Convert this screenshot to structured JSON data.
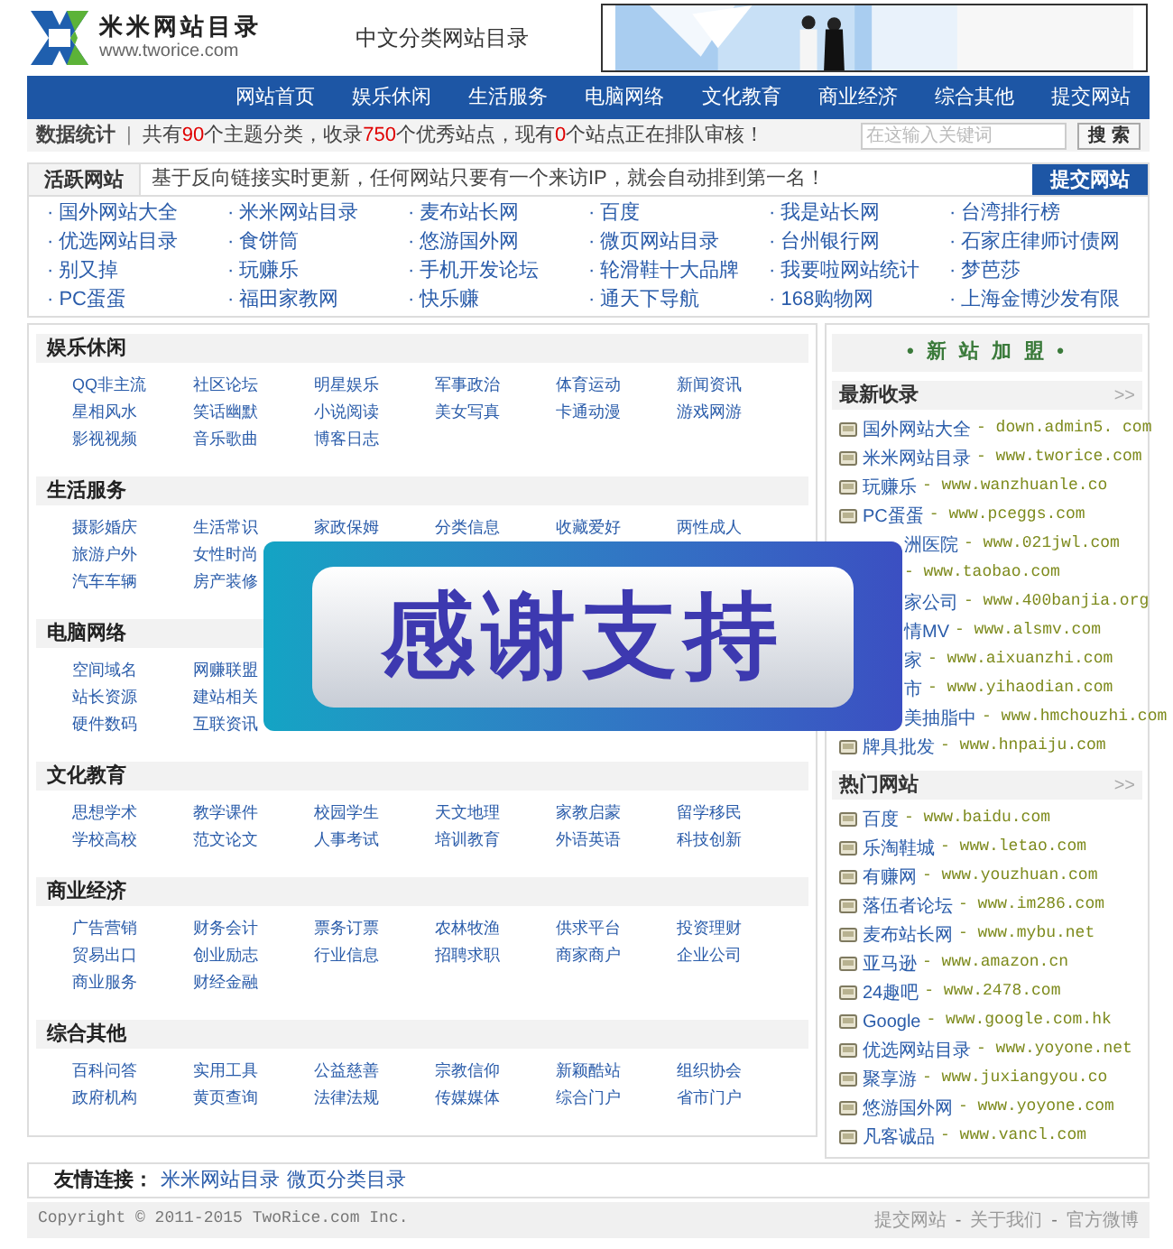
{
  "header": {
    "logo_name": "米米网站目录",
    "logo_url": "www.tworice.com",
    "site_title": "中文分类网站目录"
  },
  "nav": [
    "网站首页",
    "娱乐休闲",
    "生活服务",
    "电脑网络",
    "文化教育",
    "商业经济",
    "综合其他",
    "提交网站"
  ],
  "stats": {
    "label": "数据统计",
    "separator": "|",
    "parts": [
      {
        "text": "共有",
        "highlight": false
      },
      {
        "text": "90",
        "highlight": true
      },
      {
        "text": "个主题分类，收录",
        "highlight": false
      },
      {
        "text": "750",
        "highlight": true
      },
      {
        "text": "个优秀站点，现有",
        "highlight": false
      },
      {
        "text": "0",
        "highlight": true
      },
      {
        "text": "个站点正在排队审核！",
        "highlight": false
      }
    ],
    "search": {
      "placeholder": "在这输入关键词"
    },
    "search_button": "搜 索"
  },
  "active_sites": {
    "label": "活跃网站",
    "notice": "基于反向链接实时更新，任何网站只要有一个来访IP，就会自动排到第一名！",
    "submit": "提交网站",
    "links": [
      "· 国外网站大全",
      "· 米米网站目录",
      "· 麦布站长网",
      "· 百度",
      "· 我是站长网",
      "· 台湾排行榜",
      "· 优选网站目录",
      "· 食饼筒",
      "· 悠游国外网",
      "· 微页网站目录",
      "· 台州银行网",
      "· 石家庄律师讨债网",
      "· 别又掉",
      "· 玩赚乐",
      "· 手机开发论坛",
      "· 轮滑鞋十大品牌",
      "· 我要啦网站统计",
      "· 梦芭莎",
      "· PC蛋蛋",
      "· 福田家教网",
      "· 快乐赚",
      "· 通天下导航",
      "· 168购物网",
      "· 上海金博沙发有限"
    ]
  },
  "categories": [
    {
      "title": "娱乐休闲",
      "links": [
        [
          "QQ非主流",
          "社区论坛",
          "明星娱乐",
          "军事政治",
          "体育运动",
          "新闻资讯"
        ],
        [
          "星相风水",
          "笑话幽默",
          "小说阅读",
          "美女写真",
          "卡通动漫",
          "游戏网游"
        ],
        [
          "影视视频",
          "音乐歌曲",
          "博客日志"
        ]
      ]
    },
    {
      "title": "生活服务",
      "links": [
        [
          "摄影婚庆",
          "生活常识",
          "家政保姆",
          "分类信息",
          "收藏爱好",
          "两性成人"
        ],
        [
          "旅游户外",
          "女性时尚"
        ],
        [
          "汽车车辆",
          "房产装修"
        ]
      ]
    },
    {
      "title": "电脑网络",
      "links": [
        [
          "空间域名",
          "网赚联盟"
        ],
        [
          "站长资源",
          "建站相关"
        ],
        [
          "硬件数码",
          "互联资讯"
        ]
      ]
    },
    {
      "title": "文化教育",
      "links": [
        [
          "思想学术",
          "教学课件",
          "校园学生",
          "天文地理",
          "家教启蒙",
          "留学移民"
        ],
        [
          "学校高校",
          "范文论文",
          "人事考试",
          "培训教育",
          "外语英语",
          "科技创新"
        ]
      ]
    },
    {
      "title": "商业经济",
      "links": [
        [
          "广告营销",
          "财务会计",
          "票务订票",
          "农林牧渔",
          "供求平台",
          "投资理财"
        ],
        [
          "贸易出口",
          "创业励志",
          "行业信息",
          "招聘求职",
          "商家商户",
          "企业公司"
        ],
        [
          "商业服务",
          "财经金融"
        ]
      ]
    },
    {
      "title": "综合其他",
      "links": [
        [
          "百科问答",
          "实用工具",
          "公益慈善",
          "宗教信仰",
          "新颖酷站",
          "组织协会"
        ],
        [
          "政府机构",
          "黄页查询",
          "法律法规",
          "传媒媒体",
          "综合门户",
          "省市门户"
        ]
      ]
    }
  ],
  "sidebar": {
    "title": "• 新 站 加 盟 •",
    "sections": [
      {
        "title": "最新收录",
        "more": ">>",
        "items": [
          {
            "name": "国外网站大全",
            "url": "- down.admin5. com",
            "covered": false
          },
          {
            "name": "米米网站目录",
            "url": "- www.tworice.com",
            "covered": false
          },
          {
            "name": "玩赚乐",
            "url": "- www.wanzhuanle.co",
            "covered": false
          },
          {
            "name": "PC蛋蛋",
            "url": "- www.pceggs.com",
            "covered": false
          },
          {
            "name": "洲医院",
            "url": "- www.021jwl.com",
            "covered": true
          },
          {
            "url": "- www.taobao.com",
            "covered": true
          },
          {
            "name": "家公司",
            "url": "- www.400banjia.org",
            "covered": true
          },
          {
            "name": "情MV",
            "url": "- www.alsmv.com",
            "covered": true
          },
          {
            "name": "家",
            "url": "- www.aixuanzhi.com",
            "covered": true
          },
          {
            "name": "市",
            "url": "- www.yihaodian.com",
            "covered": true
          },
          {
            "name": "美抽脂中",
            "url": "- www.hmchouzhi.com",
            "covered": true
          },
          {
            "name": "牌具批发",
            "url": "- www.hnpaiju.com",
            "covered": false
          }
        ]
      },
      {
        "title": "热门网站",
        "more": ">>",
        "items": [
          {
            "name": "百度",
            "url": "- www.baidu.com",
            "covered": false
          },
          {
            "name": "乐淘鞋城",
            "url": "- www.letao.com",
            "covered": false
          },
          {
            "name": "有赚网",
            "url": "- www.youzhuan.com",
            "covered": false
          },
          {
            "name": "落伍者论坛",
            "url": "- www.im286.com",
            "covered": false
          },
          {
            "name": "麦布站长网",
            "url": "- www.mybu.net",
            "covered": false
          },
          {
            "name": "亚马逊",
            "url": "- www.amazon.cn",
            "covered": false
          },
          {
            "name": "24趣吧",
            "url": "- www.2478.com",
            "covered": false
          },
          {
            "name": "Google",
            "url": "- www.google.com.hk",
            "covered": false
          },
          {
            "name": "优选网站目录",
            "url": "- www.yoyone.net",
            "covered": false
          },
          {
            "name": "聚享游",
            "url": "- www.juxiangyou.co",
            "covered": false
          },
          {
            "name": "悠游国外网",
            "url": "- www.yoyone.com",
            "covered": false
          },
          {
            "name": "凡客诚品",
            "url": "- www.vancl.com",
            "covered": false
          }
        ]
      }
    ]
  },
  "overlay": {
    "text": "感谢支持"
  },
  "friend_links": {
    "label": "友情连接：",
    "links": [
      "米米网站目录",
      "微页分类目录"
    ]
  },
  "footer": {
    "copyright": "Copyright © 2011-2015 TwoRice.com Inc.",
    "links": [
      "提交网站",
      "关于我们",
      "官方微博"
    ],
    "separator": "-"
  }
}
